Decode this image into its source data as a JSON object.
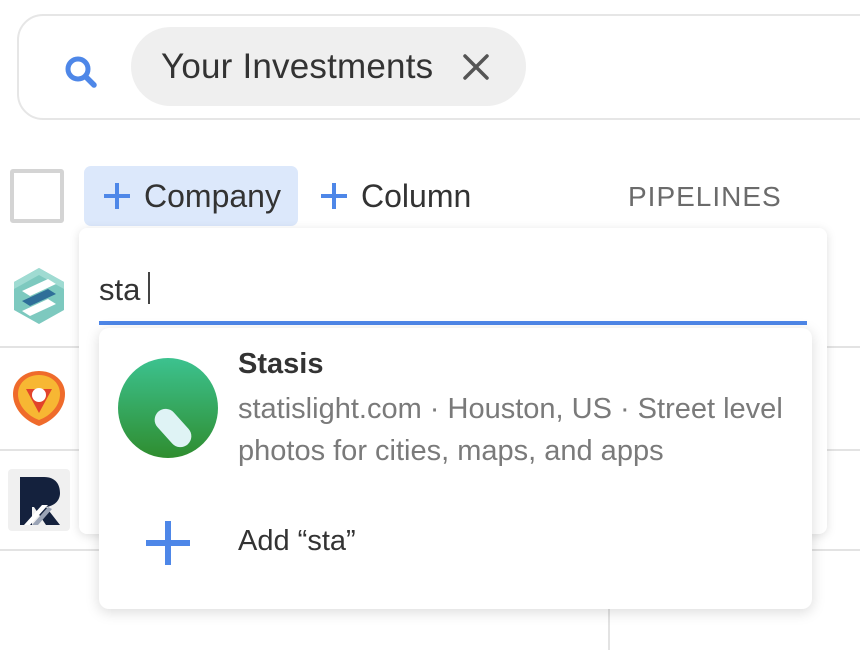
{
  "search": {
    "icon": "search-icon",
    "chip_label": "Your Investments",
    "chip_close_icon": "close-icon"
  },
  "toolbar": {
    "add_company_label": "Company",
    "add_column_label": "Column",
    "pipelines_header": "PIPELINES"
  },
  "dropdown": {
    "query": "sta",
    "results": [
      {
        "name": "Stasis",
        "description": "statislight.com · Houston, US · Street level photos for cities, maps, and apps"
      }
    ],
    "add_label": "Add “sta”"
  },
  "colors": {
    "accent": "#4e87e8",
    "button_bg": "#dce8fb",
    "chip_bg": "#efefef"
  }
}
